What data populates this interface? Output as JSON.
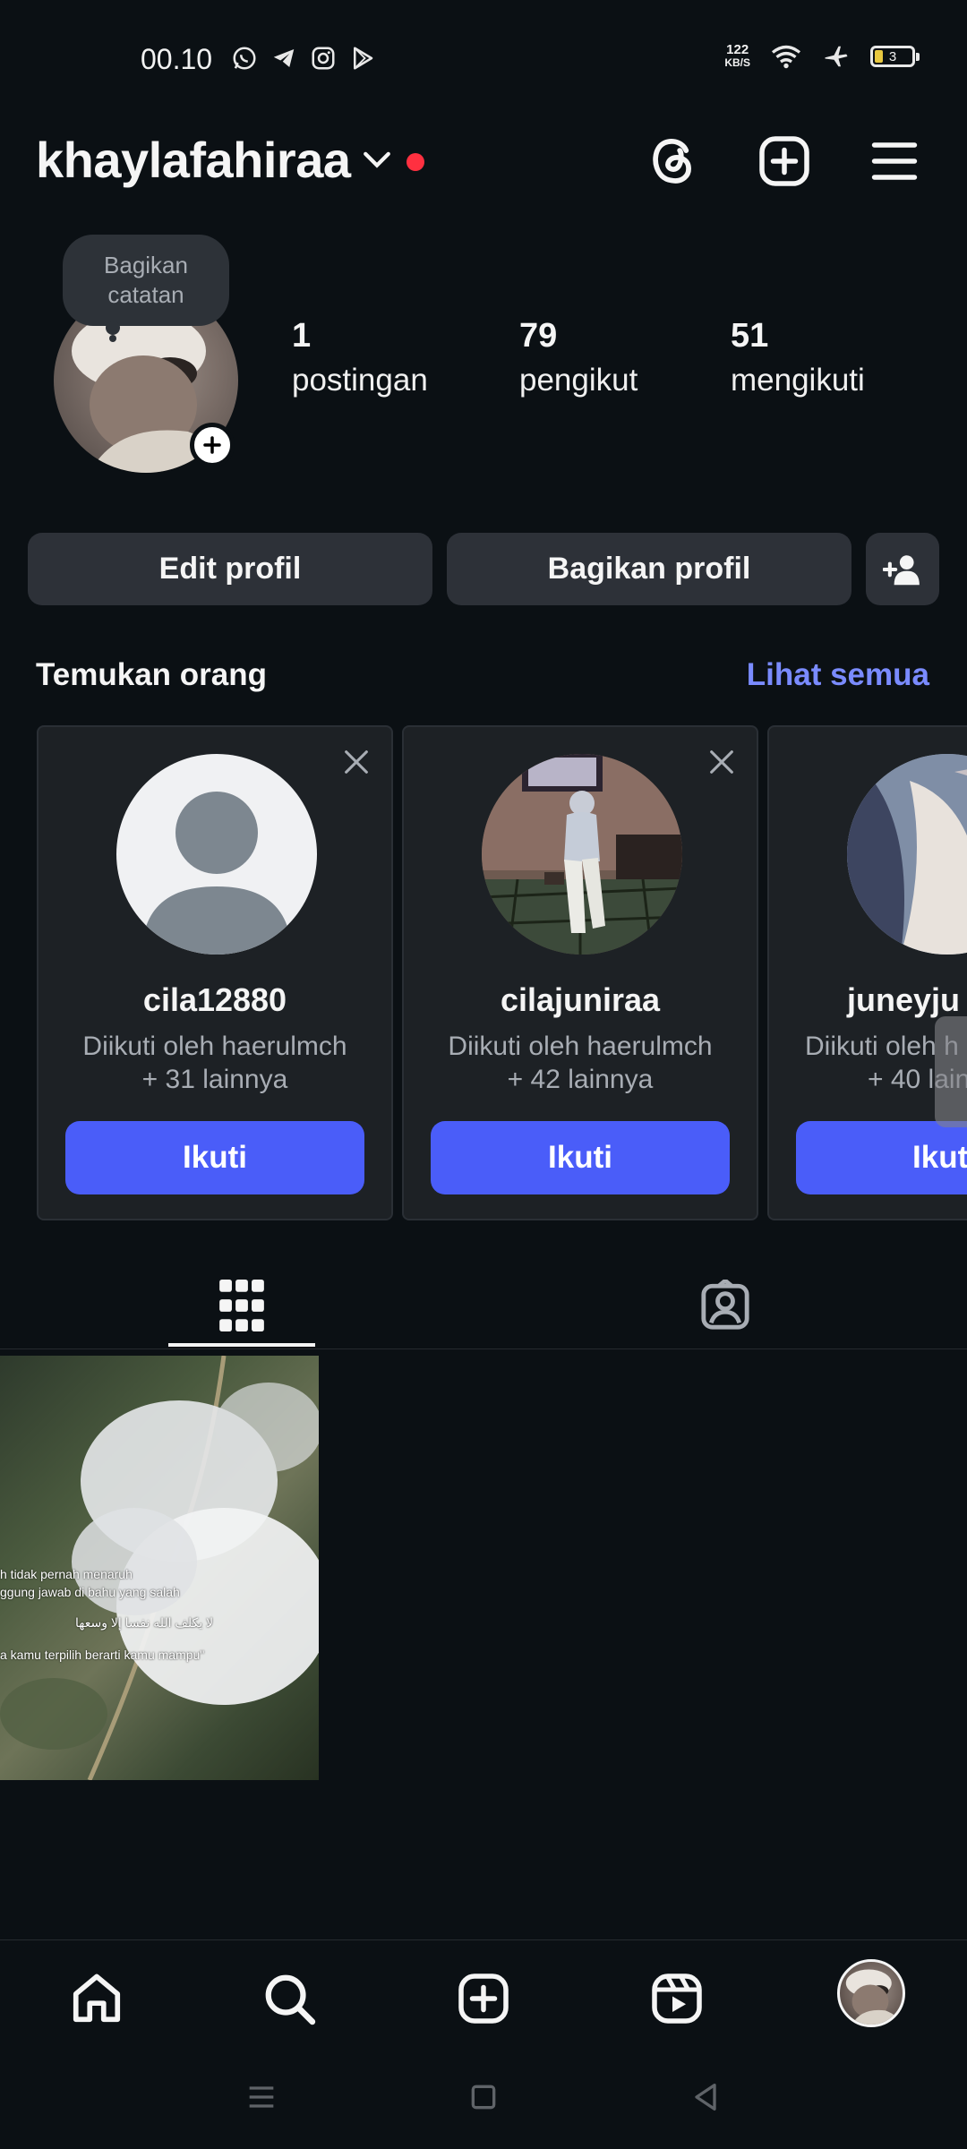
{
  "status_bar": {
    "time": "00.10",
    "app_icons": [
      "whatsapp-icon",
      "telegram-icon",
      "instagram-icon",
      "play-store-icon"
    ],
    "net_speed_value": "122",
    "net_speed_unit": "KB/S",
    "battery_level": "3"
  },
  "header": {
    "username": "khaylafahiraa",
    "has_notification_dot": true
  },
  "profile": {
    "note_text_line1": "Bagikan",
    "note_text_line2": "catatan",
    "posts_count": "1",
    "posts_label": "postingan",
    "followers_count": "79",
    "followers_label": "pengikut",
    "following_count": "51",
    "following_label": "mengikuti",
    "edit_label": "Edit profil",
    "share_label": "Bagikan profil"
  },
  "discover": {
    "title": "Temukan orang",
    "see_all": "Lihat semua",
    "cards": [
      {
        "name": "cila12880",
        "sub_line1": "Diikuti oleh haerulmch",
        "sub_line2": "+ 31 lainnya",
        "button": "Ikuti"
      },
      {
        "name": "cilajuniraa",
        "sub_line1": "Diikuti oleh haerulmch",
        "sub_line2": "+ 42 lainnya",
        "button": "Ikuti"
      },
      {
        "name": "juneyju",
        "sub_line1": "Diikuti oleh h",
        "sub_line2": "+ 40 lain",
        "button": "Ikut"
      }
    ]
  },
  "post": {
    "line1": "h tidak pernah menaruh",
    "line2": "ggung jawab di bahu yang salah",
    "line3": "لا يكلف الله نفسا إلا وسعها",
    "line4": "a kamu terpilih berarti kamu mampu\""
  },
  "colors": {
    "background": "#0b1014",
    "accent_blue": "#4a5df9",
    "link_blue": "#7a8bff",
    "notification_red": "#ff3040"
  }
}
